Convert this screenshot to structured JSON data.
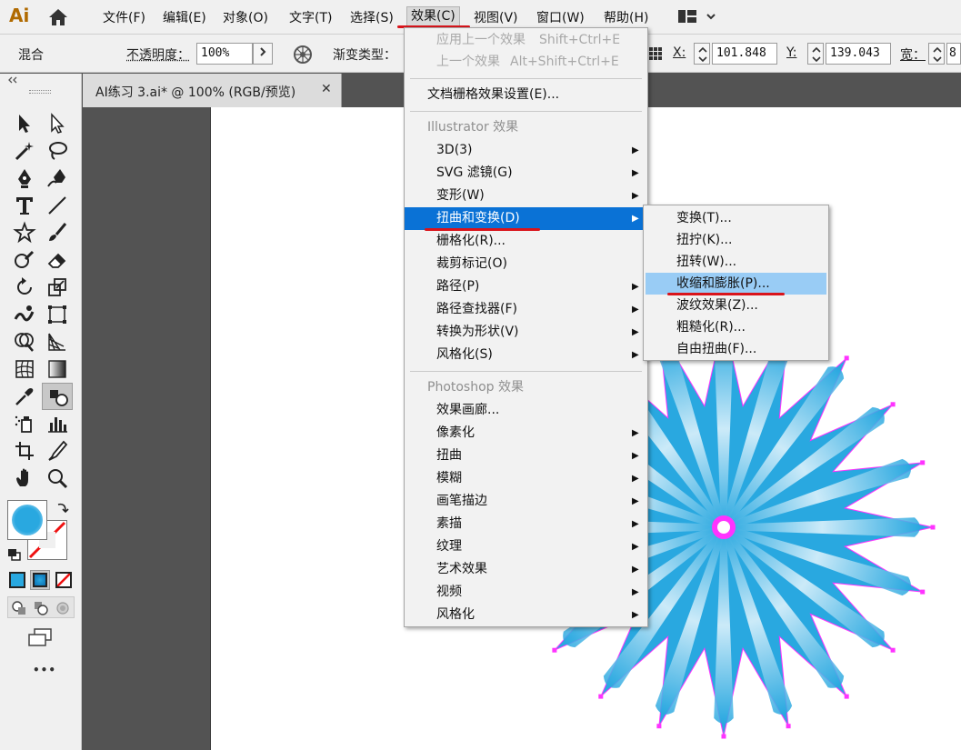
{
  "app": {
    "logo": "Ai"
  },
  "menubar": {
    "items": [
      "文件(F)",
      "编辑(E)",
      "对象(O)",
      "文字(T)",
      "选择(S)",
      "效果(C)",
      "视图(V)",
      "窗口(W)",
      "帮助(H)"
    ]
  },
  "controlbar": {
    "blend_label": "混合",
    "opacity_label": "不透明度：",
    "opacity_value": "100%",
    "gradient_type_label": "渐变类型：",
    "x_label": "X:",
    "x_value": "101.848",
    "y_label": "Y:",
    "y_value": "139.043",
    "w_label": "宽：",
    "w_value": "8"
  },
  "document": {
    "tab_title": "AI练习 3.ai* @ 100% (RGB/预览)",
    "close_glyph": "✕"
  },
  "effect_menu": {
    "apply_last": {
      "label": "应用上一个效果",
      "shortcut": "Shift+Ctrl+E"
    },
    "last_effect": {
      "label": "上一个效果",
      "shortcut": "Alt+Shift+Ctrl+E"
    },
    "doc_raster_settings": "文档栅格效果设置(E)...",
    "illustrator_header": "Illustrator 效果",
    "illustrator_items": [
      {
        "label": "3D(3)",
        "arrow": "▶"
      },
      {
        "label": "SVG 滤镜(G)",
        "arrow": "▶"
      },
      {
        "label": "变形(W)",
        "arrow": "▶"
      },
      {
        "label": "扭曲和变换(D)",
        "arrow": "▶"
      },
      {
        "label": "栅格化(R)...",
        "arrow": ""
      },
      {
        "label": "裁剪标记(O)",
        "arrow": ""
      },
      {
        "label": "路径(P)",
        "arrow": "▶"
      },
      {
        "label": "路径查找器(F)",
        "arrow": "▶"
      },
      {
        "label": "转换为形状(V)",
        "arrow": "▶"
      },
      {
        "label": "风格化(S)",
        "arrow": "▶"
      }
    ],
    "photoshop_header": "Photoshop 效果",
    "photoshop_items": [
      {
        "label": "效果画廊...",
        "arrow": ""
      },
      {
        "label": "像素化",
        "arrow": "▶"
      },
      {
        "label": "扭曲",
        "arrow": "▶"
      },
      {
        "label": "模糊",
        "arrow": "▶"
      },
      {
        "label": "画笔描边",
        "arrow": "▶"
      },
      {
        "label": "素描",
        "arrow": "▶"
      },
      {
        "label": "纹理",
        "arrow": "▶"
      },
      {
        "label": "艺术效果",
        "arrow": "▶"
      },
      {
        "label": "视频",
        "arrow": "▶"
      },
      {
        "label": "风格化",
        "arrow": "▶"
      }
    ]
  },
  "distort_submenu": {
    "items": [
      "变换(T)...",
      "扭拧(K)...",
      "扭转(W)...",
      "收缩和膨胀(P)...",
      "波纹效果(Z)...",
      "粗糙化(R)...",
      "自由扭曲(F)..."
    ]
  },
  "colors": {
    "menu_highlight": "#0a72d6",
    "submenu_highlight": "#99ccf5",
    "annotation_red": "#d9141b",
    "fill_blue": "#29a8e0",
    "anchor_magenta": "#ff33ff",
    "app_brand": "#b06a00"
  },
  "toolbar": {
    "more_glyph": "•••"
  }
}
